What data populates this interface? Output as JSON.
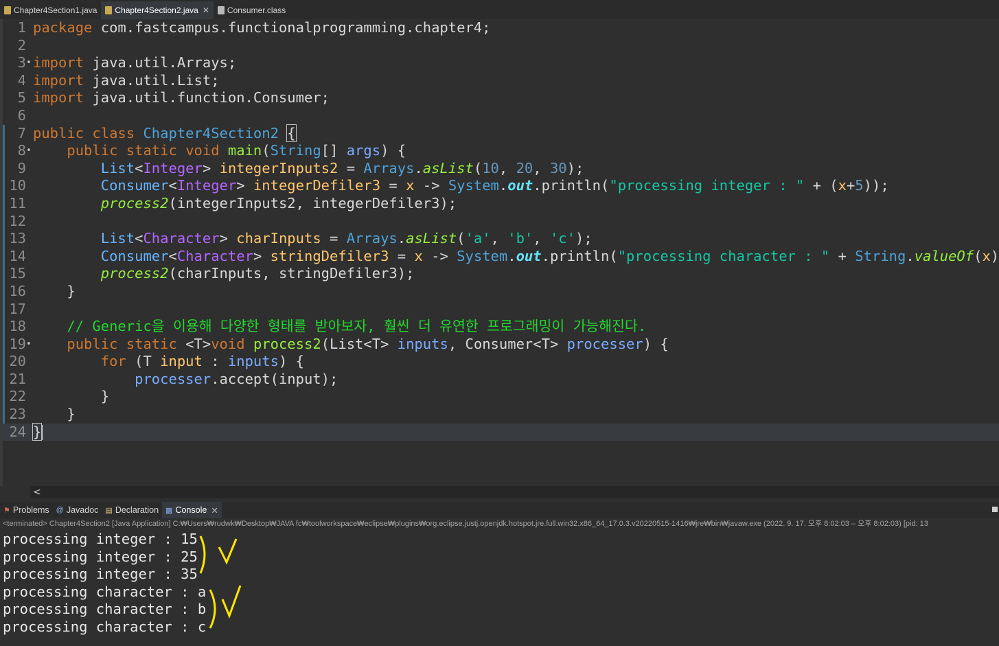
{
  "tabs": [
    {
      "label": "Chapter4Section1.java"
    },
    {
      "label": "Chapter4Section2.java"
    },
    {
      "label": "Consumer.class"
    }
  ],
  "code": {
    "l1": {
      "n": "1",
      "kw": "package",
      "rest": " com.fastcampus.functionalprogramming.chapter4;"
    },
    "l2": {
      "n": "2"
    },
    "l3": {
      "n": "3",
      "marker": "•",
      "kw": "import",
      "rest": " java.util.Arrays;"
    },
    "l4": {
      "n": "4",
      "kw": "import",
      "rest": " java.util.List;"
    },
    "l5": {
      "n": "5",
      "kw": "import",
      "rest": " java.util.function.Consumer;"
    },
    "l6": {
      "n": "6"
    },
    "l7": {
      "n": "7",
      "kw1": "public",
      "kw2": "class",
      "cls": "Chapter4Section2",
      "brace": "{"
    },
    "l8": {
      "n": "8",
      "marker": "•",
      "indent": "    ",
      "kw1": "public",
      "kw2": "static",
      "kw3": "void",
      "meth": "main",
      "p1": "(",
      "type": "String",
      "p2": "[] ",
      "arg": "args",
      "p3": ") {"
    },
    "l9": {
      "n": "9",
      "indent": "        ",
      "t1": "List",
      "a": "<",
      "t2": "Integer",
      "b": "> ",
      "var": "integerInputs2",
      "eq": " = ",
      "t3": "Arrays",
      "dot": ".",
      "sm": "asList",
      "o": "(",
      "n1": "10",
      "c1": ", ",
      "n2": "20",
      "c2": ", ",
      "n3": "30",
      "e": ");"
    },
    "l10": {
      "n": "10",
      "indent": "        ",
      "t1": "Consumer",
      "a": "<",
      "t2": "Integer",
      "b": "> ",
      "var": "integerDefiler3",
      "eq": " = ",
      "x": "x",
      "arrow": " -> ",
      "sys": "System",
      "dot": ".",
      "out": "out",
      "pr": ".println(",
      "str": "\"processing integer : \"",
      "plus": " + (",
      "x2": "x",
      "pl": "+",
      "five": "5",
      "e": "));"
    },
    "l11": {
      "n": "11",
      "indent": "        ",
      "call": "process2",
      "args": "(integerInputs2, integerDefiler3);"
    },
    "l12": {
      "n": "12"
    },
    "l13": {
      "n": "13",
      "indent": "        ",
      "t1": "List",
      "a": "<",
      "t2": "Character",
      "b": "> ",
      "var": "charInputs",
      "eq": " = ",
      "t3": "Arrays",
      "dot": ".",
      "sm": "asList",
      "o": "(",
      "s1": "'a'",
      "c1": ", ",
      "s2": "'b'",
      "c2": ", ",
      "s3": "'c'",
      "e": ");"
    },
    "l14": {
      "n": "14",
      "indent": "        ",
      "t1": "Consumer",
      "a": "<",
      "t2": "Character",
      "b": "> ",
      "var": "stringDefiler3",
      "eq": " = ",
      "x": "x",
      "arrow": " -> ",
      "sys": "System",
      "dot": ".",
      "out": "out",
      "pr": ".println(",
      "str": "\"processing character : \"",
      "plus": " + ",
      "t3": "String",
      "dot2": ".",
      "vo": "valueOf",
      "o": "(",
      "x2": "x",
      "e": "));"
    },
    "l15": {
      "n": "15",
      "indent": "        ",
      "call": "process2",
      "args": "(charInputs, stringDefiler3);"
    },
    "l16": {
      "n": "16",
      "indent": "    ",
      "rest": "}"
    },
    "l17": {
      "n": "17"
    },
    "l18": {
      "n": "18",
      "indent": "    ",
      "comment": "// Generic을 이용해 다양한 형태를 받아보자, 훨씬 더 유연한 프로그래밍이 가능해진다."
    },
    "l19": {
      "n": "19",
      "marker": "•",
      "indent": "    ",
      "kw1": "public",
      "kw2": "static",
      "gen": " <T>",
      "kw3": "void",
      "meth": "process2",
      "o": "(",
      "t1": "List",
      "g": "<T> ",
      "v1": "inputs",
      "c": ", ",
      "t2": "Consumer",
      "g2": "<T> ",
      "v2": "processer",
      "e": ") {"
    },
    "l20": {
      "n": "20",
      "indent": "        ",
      "kw": "for",
      "o": " (T ",
      "v1": "input",
      "col": " : ",
      "v2": "inputs",
      "e": ") {"
    },
    "l21": {
      "n": "21",
      "indent": "            ",
      "v": "processer",
      "rest": ".accept(input);"
    },
    "l22": {
      "n": "22",
      "indent": "        ",
      "rest": "}"
    },
    "l23": {
      "n": "23",
      "indent": "    ",
      "rest": "}"
    },
    "l24": {
      "n": "24",
      "rest": "}"
    }
  },
  "views": [
    {
      "label": "Problems"
    },
    {
      "label": "Javadoc"
    },
    {
      "label": "Declaration"
    },
    {
      "label": "Console"
    }
  ],
  "console": {
    "status": "<terminated> Chapter4Section2 [Java Application] C:₩Users₩rudwk₩Desktop₩JAVA fc₩toolworkspace₩eclipse₩plugins₩org.eclipse.justj.openjdk.hotspot.jre.full.win32.x86_64_17.0.3.v20220515-1416₩jre₩bin₩javaw.exe  (2022. 9. 17. 오후 8:02:03 – 오후 8:02:03) [pid: 13",
    "lines": [
      "processing integer : 15",
      "processing integer : 25",
      "processing integer : 35",
      "processing character : a",
      "processing character : b",
      "processing character : c"
    ]
  },
  "icons": [
    "java-file-icon",
    "class-file-icon",
    "problems-icon",
    "javadoc-icon",
    "declaration-icon",
    "console-icon"
  ],
  "colors": {
    "keyword": "#cc7832",
    "type": "#4fa3d8",
    "string": "#17c6a3",
    "comment": "#23d72f",
    "annotation": "#ffe600"
  }
}
